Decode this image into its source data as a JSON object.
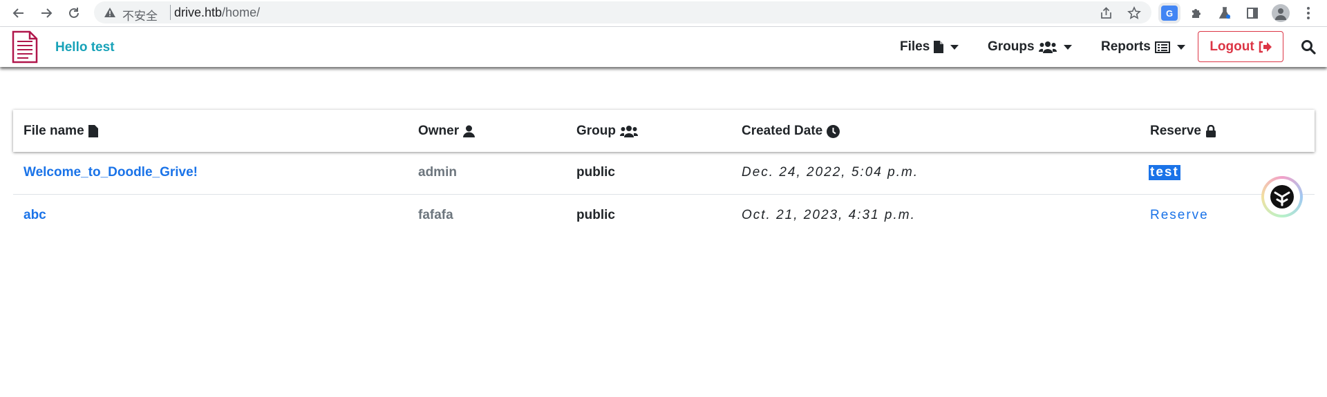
{
  "browser": {
    "security_label": "不安全",
    "url_host": "drive.htb",
    "url_path": "/home/",
    "translate_label": "G"
  },
  "navbar": {
    "greeting": "Hello test",
    "files_label": "Files",
    "groups_label": "Groups",
    "reports_label": "Reports",
    "logout_label": "Logout"
  },
  "table": {
    "headers": {
      "file_name": "File name",
      "owner": "Owner",
      "group": "Group",
      "created_date": "Created Date",
      "reserve": "Reserve"
    },
    "rows": [
      {
        "file_name": "Welcome_to_Doodle_Grive!",
        "owner": "admin",
        "group": "public",
        "created": "Dec. 24, 2022, 5:04 p.m.",
        "reserve": "test"
      },
      {
        "file_name": "abc",
        "owner": "fafafa",
        "group": "public",
        "created": "Oct. 21, 2023, 4:31 p.m.",
        "reserve": "Reserve"
      }
    ]
  },
  "colors": {
    "greeting": "#17a2b8",
    "logout": "#dc3545",
    "link": "#1a73e8",
    "owner_text": "#6c757d",
    "selection": "#1a73e8",
    "brand_logo": "#b0164b"
  }
}
